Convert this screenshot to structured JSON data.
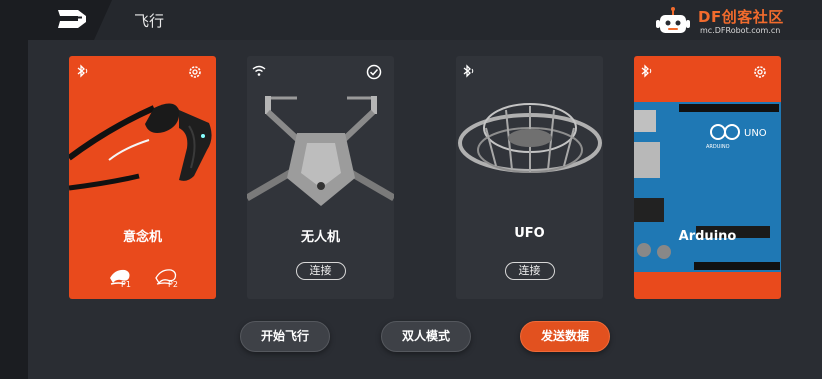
{
  "header": {
    "title": "飞行",
    "brand_name": "DF创客社区",
    "brand_url": "mc.DFRobot.com.cn"
  },
  "cards": [
    {
      "title": "意念机",
      "type": "headset",
      "left_icon": "bluetooth-icon",
      "right_icon": "settings-icon",
      "players": [
        "P1",
        "P2"
      ]
    },
    {
      "title": "无人机",
      "type": "drone",
      "left_icon": "wifi-icon",
      "right_icon": "check-circle-icon",
      "button": "连接"
    },
    {
      "title": "UFO",
      "type": "ufo",
      "left_icon": "bluetooth-icon",
      "button": "连接"
    },
    {
      "title": "Arduino",
      "type": "arduino",
      "left_icon": "bluetooth-icon",
      "right_icon": "settings-icon"
    }
  ],
  "actions": {
    "start_flight": "开始飞行",
    "dual_mode": "双人模式",
    "send_data": "发送数据"
  },
  "colors": {
    "accent": "#e94a1c",
    "background": "#2a2d33",
    "card_dark": "#31343a"
  }
}
